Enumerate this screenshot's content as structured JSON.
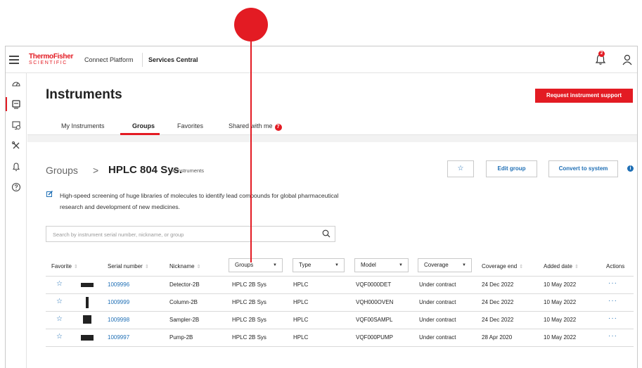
{
  "topbar": {
    "logo_line1": "ThermoFisher",
    "logo_line2": "SCIENTIFIC",
    "platform": "Connect Platform",
    "service": "Services Central",
    "notification_count": "2"
  },
  "header": {
    "title": "Instruments",
    "request_button": "Request instrument support",
    "tabs": [
      {
        "label": "My Instruments"
      },
      {
        "label": "Groups"
      },
      {
        "label": "Favorites"
      },
      {
        "label": "Shared with me"
      }
    ],
    "shared_badge": "7"
  },
  "group": {
    "crumb_root": "Groups",
    "crumb_sep": ">",
    "name": "HPLC 804 Sys.",
    "count": "4 instruments",
    "star_glyph": "☆",
    "edit_button": "Edit group",
    "convert_button": "Convert to system",
    "info_glyph": "i",
    "description": "High-speed screening of huge libraries of molecules to identify lead compounds for global pharmaceutical research and development of new medicines."
  },
  "search": {
    "placeholder": "Search by instrument serial number, nickname, or group",
    "value": ""
  },
  "table": {
    "columns": {
      "favorite": "Favorite",
      "serial": "Serial number",
      "nickname": "Nickname",
      "groups": "Groups",
      "type": "Type",
      "model": "Model",
      "coverage": "Coverage",
      "coverage_end": "Coverage end",
      "added": "Added date",
      "actions": "Actions"
    },
    "sort_glyph": "⇕",
    "caret_glyph": "▼",
    "rows": [
      {
        "serial": "1009996",
        "nickname": "Detector-2B",
        "group": "HPLC 2B Sys",
        "type": "HPLC",
        "model": "VQF0000DET",
        "coverage": "Under contract",
        "coverage_end": "24 Dec 2022",
        "added": "10 May 2022",
        "actions": "···"
      },
      {
        "serial": "1009999",
        "nickname": "Column-2B",
        "group": "HPLC 2B Sys",
        "type": "HPLC",
        "model": "VQH000OVEN",
        "coverage": "Under contract",
        "coverage_end": "24 Dec 2022",
        "added": "10 May 2022",
        "actions": "···"
      },
      {
        "serial": "1009998",
        "nickname": "Sampler-2B",
        "group": "HPLC 2B Sys",
        "type": "HPLC",
        "model": "VQF00SAMPL",
        "coverage": "Under contract",
        "coverage_end": "24 Dec 2022",
        "added": "10 May 2022",
        "actions": "···"
      },
      {
        "serial": "1009997",
        "nickname": "Pump-2B",
        "group": "HPLC 2B Sys",
        "type": "HPLC",
        "model": "VQF000PUMP",
        "coverage": "Under contract",
        "coverage_end": "28 Apr 2020",
        "added": "10 May 2022",
        "actions": "···"
      }
    ]
  },
  "colors": {
    "brand_red": "#e31b23",
    "link_blue": "#1f6fb5"
  },
  "icons": [
    "hamburger-icon",
    "bell-icon",
    "user-icon",
    "dashboard-icon",
    "instrument-icon",
    "monitor-icon",
    "tools-icon",
    "alert-icon",
    "help-icon",
    "edit-icon",
    "search-icon",
    "star-icon",
    "info-icon",
    "more-icon"
  ]
}
